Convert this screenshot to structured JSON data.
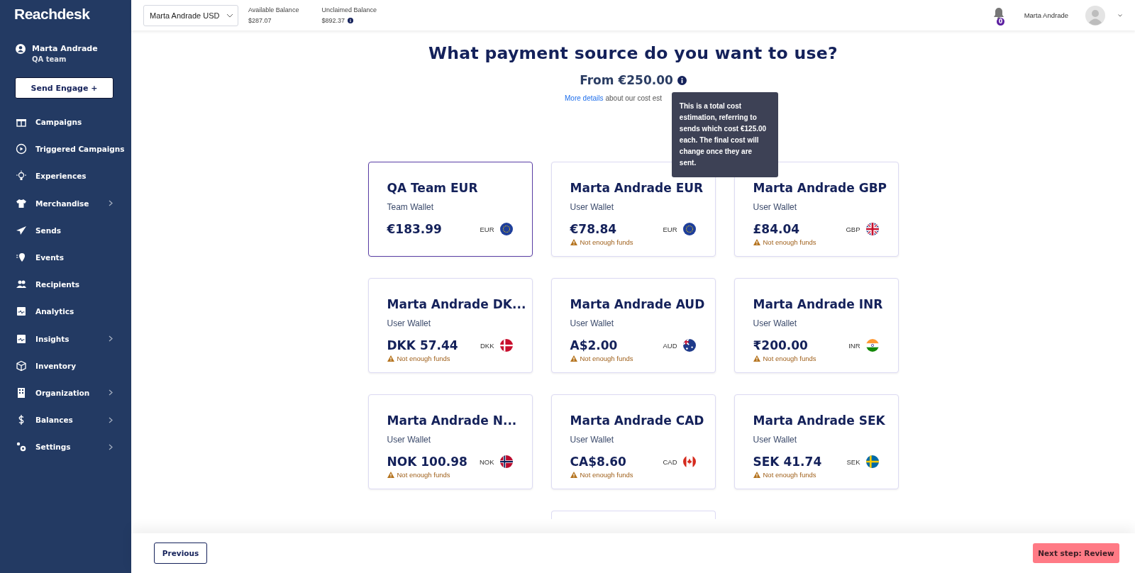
{
  "sidebar": {
    "logo": "Reachdesk",
    "user": {
      "name": "Marta Andrade",
      "team": "QA team"
    },
    "send_button": "Send Engage +",
    "items": [
      {
        "label": "Campaigns",
        "submenu": false
      },
      {
        "label": "Triggered Campaigns",
        "submenu": false
      },
      {
        "label": "Experiences",
        "submenu": false
      },
      {
        "label": "Merchandise",
        "submenu": true
      },
      {
        "label": "Sends",
        "submenu": false
      },
      {
        "label": "Events",
        "submenu": false
      },
      {
        "label": "Recipients",
        "submenu": false
      },
      {
        "label": "Analytics",
        "submenu": false
      },
      {
        "label": "Insights",
        "submenu": true
      },
      {
        "label": "Inventory",
        "submenu": false
      },
      {
        "label": "Organization",
        "submenu": true
      },
      {
        "label": "Balances",
        "submenu": true
      },
      {
        "label": "Settings",
        "submenu": true
      }
    ]
  },
  "topbar": {
    "wallet_select": "Marta Andrade USD",
    "available_label": "Available Balance",
    "available": "$287.07",
    "unclaimed_label": "Unclaimed Balance",
    "unclaimed": "$892.37",
    "notifications": "0",
    "user": "Marta Andrade"
  },
  "heading": "What payment source do you want to use?",
  "cost": "From €250.00",
  "details": {
    "link": "More details",
    "text": "about our cost est"
  },
  "tooltip": "This is a total cost estimation, referring to sends which cost €125.00 each. The final cost will change once they are sent.",
  "wallets": [
    {
      "name": "QA Team EUR",
      "type": "Team Wallet",
      "balance": "€183.99",
      "currency": "EUR",
      "selected": true
    },
    {
      "name": "Marta Andrade EUR",
      "type": "User Wallet",
      "balance": "€78.84",
      "currency": "EUR",
      "warning": "Not enough funds",
      "selected": false
    },
    {
      "name": "Marta Andrade GBP",
      "type": "User Wallet",
      "balance": "£84.04",
      "currency": "GBP",
      "warning": "Not enough funds",
      "selected": false
    },
    {
      "name": "Marta Andrade DK...",
      "type": "User Wallet",
      "balance": "DKK 57.44",
      "currency": "DKK",
      "warning": "Not enough funds",
      "selected": false
    },
    {
      "name": "Marta Andrade AUD",
      "type": "User Wallet",
      "balance": "A$2.00",
      "currency": "AUD",
      "warning": "Not enough funds",
      "selected": false
    },
    {
      "name": "Marta Andrade INR",
      "type": "User Wallet",
      "balance": "₹200.00",
      "currency": "INR",
      "warning": "Not enough funds",
      "selected": false
    },
    {
      "name": "Marta Andrade N...",
      "type": "User Wallet",
      "balance": "NOK 100.98",
      "currency": "NOK",
      "warning": "Not enough funds",
      "selected": false
    },
    {
      "name": "Marta Andrade CAD",
      "type": "User Wallet",
      "balance": "CA$8.60",
      "currency": "CAD",
      "warning": "Not enough funds",
      "selected": false
    },
    {
      "name": "Marta Andrade SEK",
      "type": "User Wallet",
      "balance": "SEK 41.74",
      "currency": "SEK",
      "warning": "Not enough funds",
      "selected": false
    }
  ],
  "more_below": true,
  "footer": {
    "previous": "Previous",
    "next": "Next step: Review"
  }
}
